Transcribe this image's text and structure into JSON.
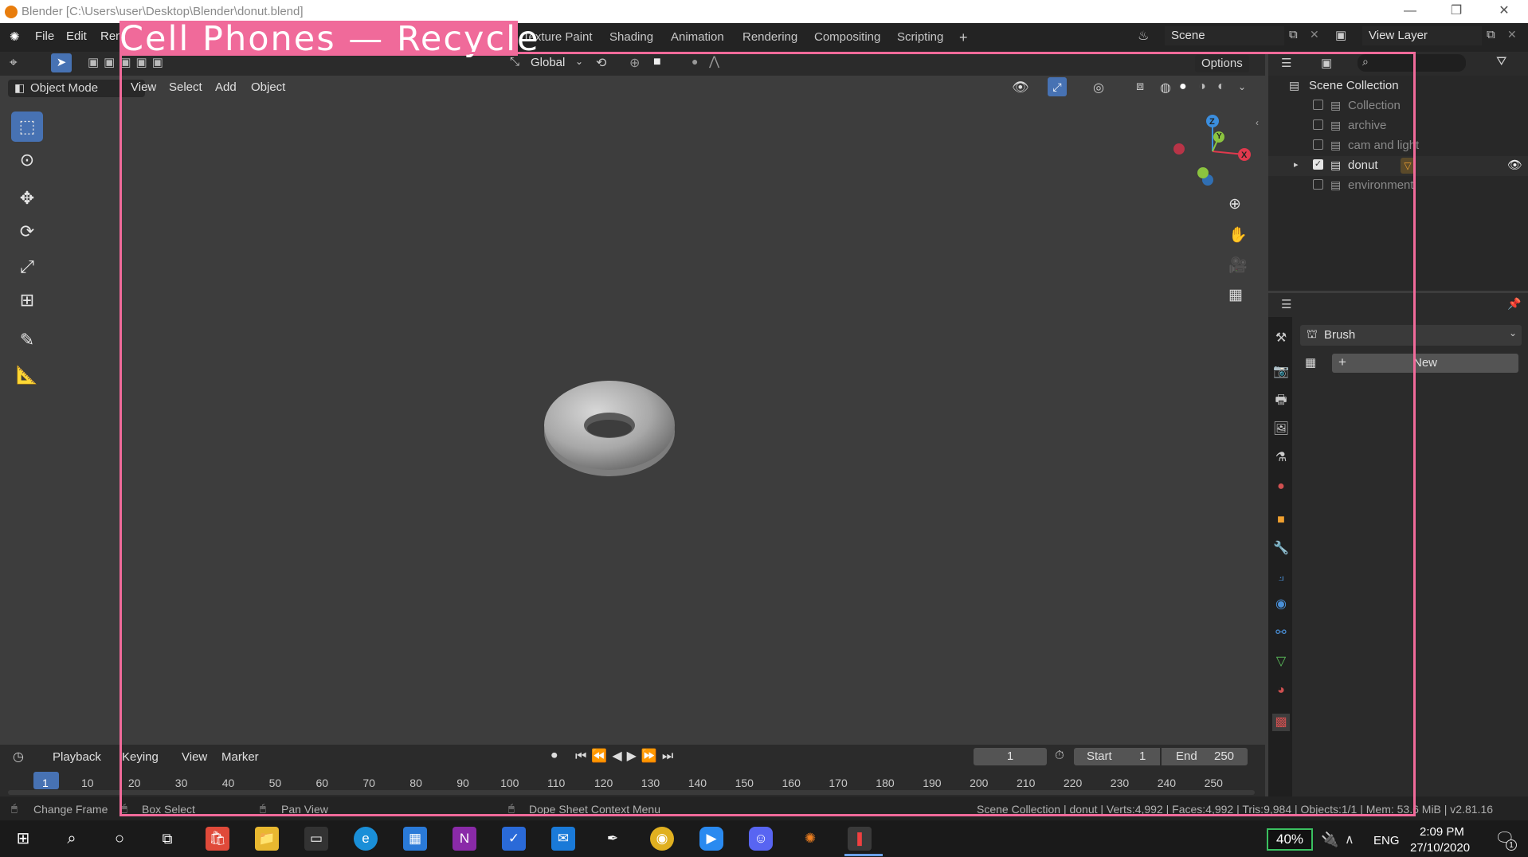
{
  "window": {
    "title": "Blender [C:\\Users\\user\\Desktop\\Blender\\donut.blend]",
    "minimize": "—",
    "restore": "❐",
    "close": "✕"
  },
  "topbar": {
    "menus": [
      "File",
      "Edit",
      "Ren"
    ],
    "workspaces": [
      "Texture Paint",
      "Shading",
      "Animation",
      "Rendering",
      "Compositing",
      "Scripting"
    ],
    "add_tab": "+",
    "scene": "Scene",
    "view_layer": "View Layer"
  },
  "banner": {
    "text": "Cell Phones — Recycle"
  },
  "viewport_header": {
    "transform_orientation": "Global",
    "options": "Options",
    "mode": "Object Mode",
    "menus": [
      "View",
      "Select",
      "Add",
      "Object"
    ]
  },
  "gizmo": {
    "x": "X",
    "y": "Y",
    "z": "Z"
  },
  "outliner": {
    "root": "Scene Collection",
    "items": [
      {
        "label": "Collection",
        "checked": false
      },
      {
        "label": "archive",
        "checked": false
      },
      {
        "label": "cam and light",
        "checked": false
      },
      {
        "label": "donut",
        "checked": true
      },
      {
        "label": "environment",
        "checked": false
      }
    ]
  },
  "properties": {
    "brush_label": "Brush",
    "new_button": "New",
    "add": "+"
  },
  "timeline": {
    "menus": [
      "Playback",
      "Keying",
      "View",
      "Marker"
    ],
    "current_frame": "1",
    "start_label": "Start",
    "start_value": "1",
    "end_label": "End",
    "end_value": "250",
    "ruler": [
      "1",
      "10",
      "20",
      "30",
      "40",
      "50",
      "60",
      "70",
      "80",
      "90",
      "100",
      "110",
      "120",
      "130",
      "140",
      "150",
      "160",
      "170",
      "180",
      "190",
      "200",
      "210",
      "220",
      "230",
      "240",
      "250"
    ]
  },
  "statusbar": {
    "change_frame": "Change Frame",
    "box_select": "Box Select",
    "pan_view": "Pan View",
    "context_menu": "Dope Sheet Context Menu",
    "stats": "Scene Collection | donut | Verts:4,992 | Faces:4,992 | Tris:9,984 | Objects:1/1 | Mem: 53.6 MiB | v2.81.16"
  },
  "taskbar": {
    "battery": "40%",
    "language": "ENG",
    "time": "2:09 PM",
    "date": "27/10/2020",
    "notifications": "1"
  },
  "colors": {
    "accent": "#4772b3",
    "banner": "#f06a9a",
    "gizmo_x": "#e0394d",
    "gizmo_y": "#8bc43f",
    "gizmo_z": "#3b8ede"
  }
}
